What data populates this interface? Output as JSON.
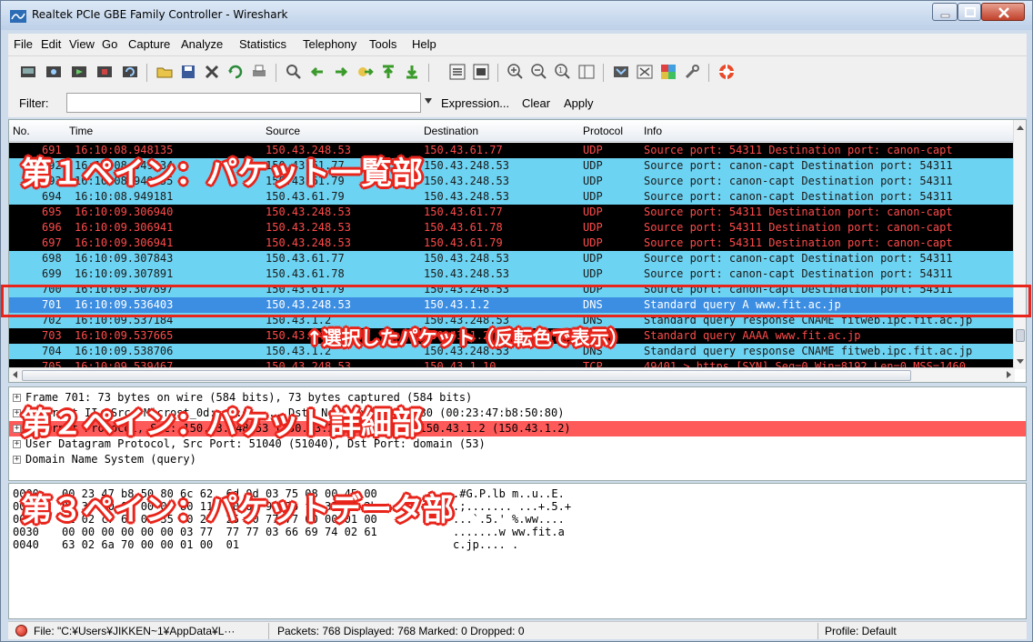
{
  "window": {
    "title": "Realtek PCIe GBE Family Controller - Wireshark"
  },
  "menu": [
    "File",
    "Edit",
    "View",
    "Go",
    "Capture",
    "Analyze",
    "Statistics",
    "Telephony",
    "Tools",
    "Help"
  ],
  "filter": {
    "label": "Filter:",
    "value": "",
    "expression": "Expression...",
    "clear": "Clear",
    "apply": "Apply"
  },
  "packet_list": {
    "columns": [
      "No.",
      "Time",
      "Source",
      "Destination",
      "Protocol",
      "Info"
    ],
    "rows": [
      {
        "no": "691",
        "time": "16:10:08.948135",
        "src": "150.43.248.53",
        "dst": "150.43.61.77",
        "proto": "UDP",
        "info": "Source port: 54311  Destination port: canon-capt",
        "color": "black"
      },
      {
        "no": "692",
        "time": "16:10:08.949134",
        "src": "150.43.61.77",
        "dst": "150.43.248.53",
        "proto": "UDP",
        "info": "Source port: canon-capt  Destination port: 54311",
        "color": "cyan"
      },
      {
        "no": "693",
        "time": "16:10:08.949155",
        "src": "150.43.61.79",
        "dst": "150.43.248.53",
        "proto": "UDP",
        "info": "Source port: canon-capt  Destination port: 54311",
        "color": "cyan"
      },
      {
        "no": "694",
        "time": "16:10:08.949181",
        "src": "150.43.61.79",
        "dst": "150.43.248.53",
        "proto": "UDP",
        "info": "Source port: canon-capt  Destination port: 54311",
        "color": "cyan"
      },
      {
        "no": "695",
        "time": "16:10:09.306940",
        "src": "150.43.248.53",
        "dst": "150.43.61.77",
        "proto": "UDP",
        "info": "Source port: 54311  Destination port: canon-capt",
        "color": "black"
      },
      {
        "no": "696",
        "time": "16:10:09.306941",
        "src": "150.43.248.53",
        "dst": "150.43.61.78",
        "proto": "UDP",
        "info": "Source port: 54311  Destination port: canon-capt",
        "color": "black"
      },
      {
        "no": "697",
        "time": "16:10:09.306941",
        "src": "150.43.248.53",
        "dst": "150.43.61.79",
        "proto": "UDP",
        "info": "Source port: 54311  Destination port: canon-capt",
        "color": "black"
      },
      {
        "no": "698",
        "time": "16:10:09.307843",
        "src": "150.43.61.77",
        "dst": "150.43.248.53",
        "proto": "UDP",
        "info": "Source port: canon-capt  Destination port: 54311",
        "color": "cyan"
      },
      {
        "no": "699",
        "time": "16:10:09.307891",
        "src": "150.43.61.78",
        "dst": "150.43.248.53",
        "proto": "UDP",
        "info": "Source port: canon-capt  Destination port: 54311",
        "color": "cyan"
      },
      {
        "no": "700",
        "time": "16:10:09.307897",
        "src": "150.43.61.79",
        "dst": "150.43.248.53",
        "proto": "UDP",
        "info": "Source port: canon-capt  Destination port: 54311",
        "color": "cyan"
      },
      {
        "no": "701",
        "time": "16:10:09.536403",
        "src": "150.43.248.53",
        "dst": "150.43.1.2",
        "proto": "DNS",
        "info": "Standard query A www.fit.ac.jp",
        "color": "sel"
      },
      {
        "no": "702",
        "time": "16:10:09.537184",
        "src": "150.43.1.2",
        "dst": "150.43.248.53",
        "proto": "DNS",
        "info": "Standard query response CNAME fitweb.ipc.fit.ac.jp",
        "color": "cyan"
      },
      {
        "no": "703",
        "time": "16:10:09.537665",
        "src": "150.43.248.53",
        "dst": "150.43.1.2",
        "proto": "DNS",
        "info": "Standard query AAAA www.fit.ac.jp",
        "color": "black"
      },
      {
        "no": "704",
        "time": "16:10:09.538706",
        "src": "150.43.1.2",
        "dst": "150.43.248.53",
        "proto": "DNS",
        "info": "Standard query response CNAME fitweb.ipc.fit.ac.jp",
        "color": "cyan"
      },
      {
        "no": "705",
        "time": "16:10:09.539467",
        "src": "150.43.248.53",
        "dst": "150.43.1.10",
        "proto": "TCP",
        "info": "49401 > https [SYN] Seq=0 Win=8192 Len=0 MSS=1460",
        "color": "black"
      }
    ]
  },
  "detail": [
    {
      "text": "Frame 701: 73 bytes on wire (584 bits), 73 bytes captured (584 bits)",
      "hl": false
    },
    {
      "text": "Ethernet II, Src: Microst_0d:...:d:..., Dst: Netsurve_b8:50:80 (00:23:47:b8:50:80)",
      "hl": false
    },
    {
      "text": "Internet Protocol, Src: 150.43.248.53 (150.43.248.53), Dst: 150.43.1.2 (150.43.1.2)",
      "hl": true
    },
    {
      "text": "User Datagram Protocol, Src Port: 51040 (51040), Dst Port: domain (53)",
      "hl": false
    },
    {
      "text": "Domain Name System (query)",
      "hl": false
    }
  ],
  "hex": [
    {
      "off": "0000",
      "bytes": "00 23 47 b8 50 80 6c 62  6d 0d 03 75 08 00 45 00",
      "ascii": ".#G.P.lb m..u..E."
    },
    {
      "off": "0010",
      "bytes": "00 3b 00 00 00 00 80 11  00 00 96 2b f8 35 96 2b",
      "ascii": ".;....... ...+.5.+"
    },
    {
      "off": "0020",
      "bytes": "01 02 c7 60 00 35 00 27  25 00 77 77 00 00 01 00",
      "ascii": "...`.5.' %.ww...."
    },
    {
      "off": "0030",
      "bytes": "00 00 00 00 00 00 03 77  77 77 03 66 69 74 02 61",
      "ascii": ".......w ww.fit.a"
    },
    {
      "off": "0040",
      "bytes": "63 02 6a 70 00 00 01 00  01",
      "ascii": "c.jp.... ."
    }
  ],
  "status": {
    "file": "File: \"C:¥Users¥JIKKEN~1¥AppData¥L···",
    "packets": "Packets: 768 Displayed: 768 Marked: 0 Dropped: 0",
    "profile": "Profile: Default"
  },
  "annotations": {
    "pane1": "第１ペイン：パケット一覧部",
    "selected": "↑選択したパケット（反転色で表示）",
    "pane2": "第２ペイン：パケット詳細部",
    "pane3": "第３ペイン：パケットデータ部"
  },
  "colors": {
    "row_black_bg": "#000000",
    "row_black_fg": "#ff4b4b",
    "row_cyan_bg": "#6dd3f2",
    "row_selected_bg": "#3c8ee2",
    "detail_highlight": "#ff5a5a",
    "annotation_outline": "#e8241b"
  }
}
